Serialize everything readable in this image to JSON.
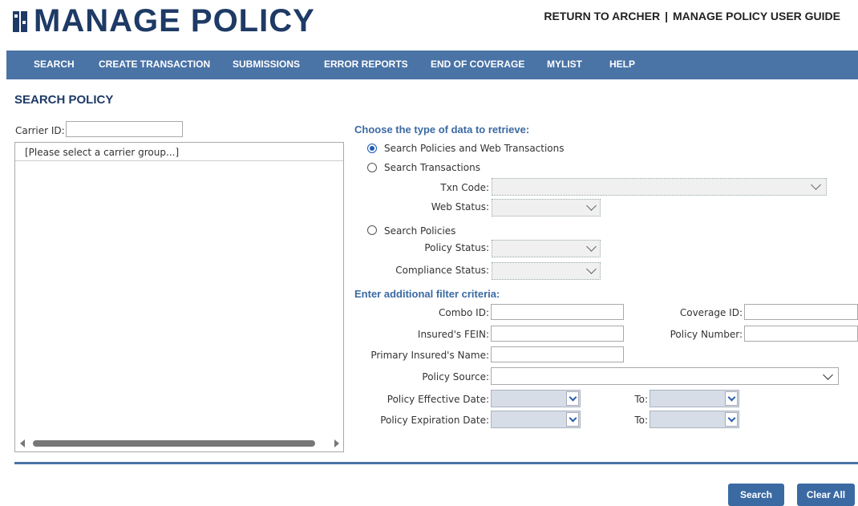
{
  "header": {
    "logo_mark": "MP",
    "title": "MANAGE POLICY",
    "return_link": "RETURN TO ARCHER",
    "separator": "|",
    "guide_link": "MANAGE POLICY USER GUIDE"
  },
  "nav": {
    "items": [
      "SEARCH",
      "CREATE TRANSACTION",
      "SUBMISSIONS",
      "ERROR REPORTS",
      "END OF COVERAGE",
      "MYLIST",
      "HELP"
    ]
  },
  "page": {
    "title": "SEARCH POLICY"
  },
  "carrier": {
    "id_label": "Carrier ID:",
    "id_value": "",
    "group_placeholder": "[Please select a carrier group...]"
  },
  "retrieve": {
    "heading": "Choose the type of data to retrieve:",
    "options": [
      "Search Policies and Web Transactions",
      "Search Transactions",
      "Search Policies"
    ],
    "selected": "Search Policies and Web Transactions",
    "txn_code_label": "Txn Code:",
    "web_status_label": "Web Status:",
    "policy_status_label": "Policy Status:",
    "compliance_status_label": "Compliance Status:"
  },
  "filters": {
    "heading": "Enter additional filter criteria:",
    "combo_id_label": "Combo ID:",
    "coverage_id_label": "Coverage ID:",
    "insured_fein_label": "Insured's FEIN:",
    "policy_number_label": "Policy Number:",
    "primary_insured_label": "Primary Insured's Name:",
    "policy_source_label": "Policy Source:",
    "effective_date_label": "Policy Effective Date:",
    "expiration_date_label": "Policy Expiration Date:",
    "to_label": "To:"
  },
  "actions": {
    "search": "Search",
    "clear_all": "Clear All"
  },
  "colors": {
    "nav_bg": "#4a73a6",
    "title": "#1e3a66",
    "accent": "#3b6aa3",
    "radio_selected": "#1e5bb8"
  }
}
